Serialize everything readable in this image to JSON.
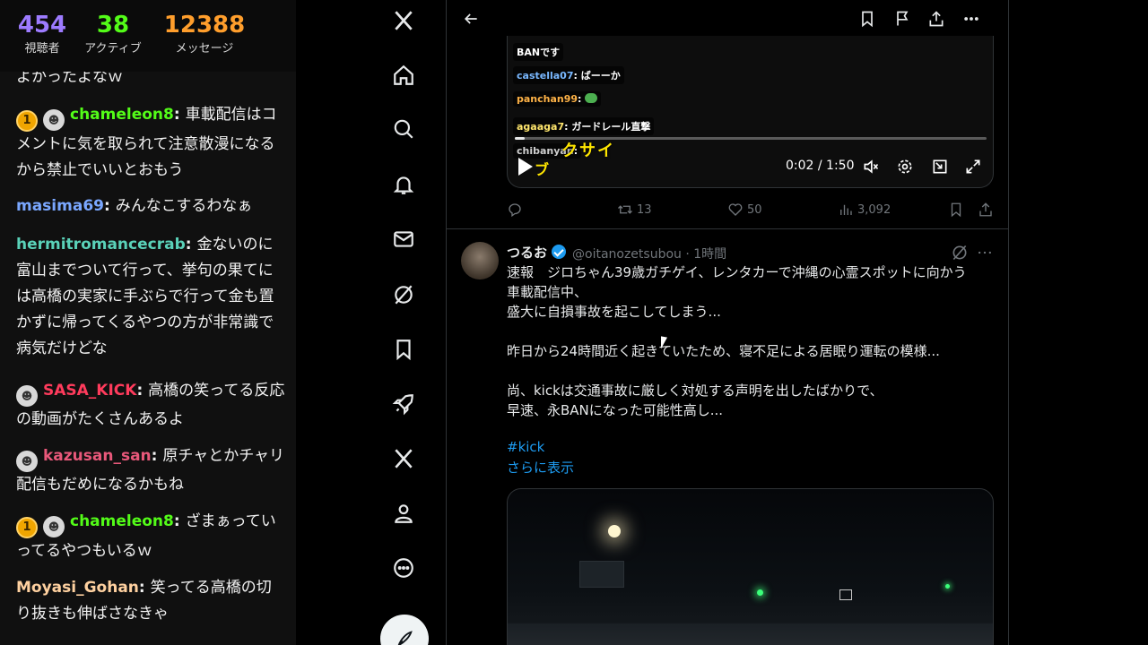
{
  "chat": {
    "stats": [
      {
        "value": "454",
        "label": "視聴者"
      },
      {
        "value": "38",
        "label": "アクティブ"
      },
      {
        "value": "12388",
        "label": "メッセージ"
      }
    ],
    "partial_top": "よかったよなｗ",
    "messages": [
      {
        "user": "chameleon8",
        "color": "#53fc18",
        "text": "車載配信はコメントに気を取られて注意散漫になるから禁止でいいとおもう",
        "badges": [
          "1",
          "avatar"
        ]
      },
      {
        "user": "masima69",
        "color": "#7aa7ff",
        "text": "みんなこするわなぁ",
        "badges": []
      },
      {
        "user": "hermitromancecrab",
        "color": "#5ad1b8",
        "text": "金ないのに富山までついて行って、挙句の果てには高橋の実家に手ぶらで行って金も置かずに帰ってくるやつの方が非常識で病気だけどな",
        "badges": []
      },
      {
        "user": "SASA_KICK",
        "color": "#ff3b5c",
        "text": "高橋の笑ってる反応の動画がたくさんあるよ",
        "badges": [
          "avatar"
        ]
      },
      {
        "user": "kazusan_san",
        "color": "#e8587a",
        "text": "原チャとかチャリ配信もだめになるかもね",
        "badges": [
          "avatar"
        ]
      },
      {
        "user": "chameleon8",
        "color": "#53fc18",
        "text": "ざまぁっていってるやつもいるｗ",
        "badges": [
          "1",
          "avatar"
        ]
      },
      {
        "user": "Moyasi_Gohan",
        "color": "#ffd1a0",
        "text": "笑ってる高橋の切り抜きも伸ばさなきゃ",
        "badges": []
      }
    ]
  },
  "nav": {
    "items": [
      "x-logo-icon",
      "home-icon",
      "search-icon",
      "bell-icon",
      "mail-icon",
      "grok-icon",
      "bookmark-icon",
      "rocket-icon",
      "x-premium-icon",
      "profile-icon",
      "more-circle-icon"
    ],
    "compose": "compose-icon"
  },
  "post1": {
    "video": {
      "chat_lines": [
        {
          "user": "",
          "text": "BANです"
        },
        {
          "user": "castella07",
          "text": "ばーーか"
        },
        {
          "user": "panchan99",
          "text": ""
        },
        {
          "user": "agaaga7",
          "text": "ガードレール直撃"
        },
        {
          "user": "chibanyan",
          "text": ""
        }
      ],
      "overlay_text": "クサイ",
      "overlay_text2": "ブ",
      "time": "0:02 / 1:50",
      "progress": 0.02
    },
    "actions": {
      "retweets": "13",
      "likes": "50",
      "views": "3,092"
    }
  },
  "post2": {
    "name": "つるお",
    "handle": "@oitanozetsubou · 1時間",
    "lines": [
      "速報　ジロちゃん39歳ガチゲイ、レンタカーで沖縄の心霊スポットに向かう",
      "車載配信中、",
      "盛大に自損事故を起こしてしまう...",
      "",
      "昨日から24時間近く起きていたため、寝不足による居眠り運転の模様...",
      "",
      "尚、kickは交通事故に厳しく対処する声明を出したばかりで、",
      "早速、永BANになった可能性高し..."
    ],
    "hashtag": "#kick",
    "show_more": "さらに表示"
  }
}
